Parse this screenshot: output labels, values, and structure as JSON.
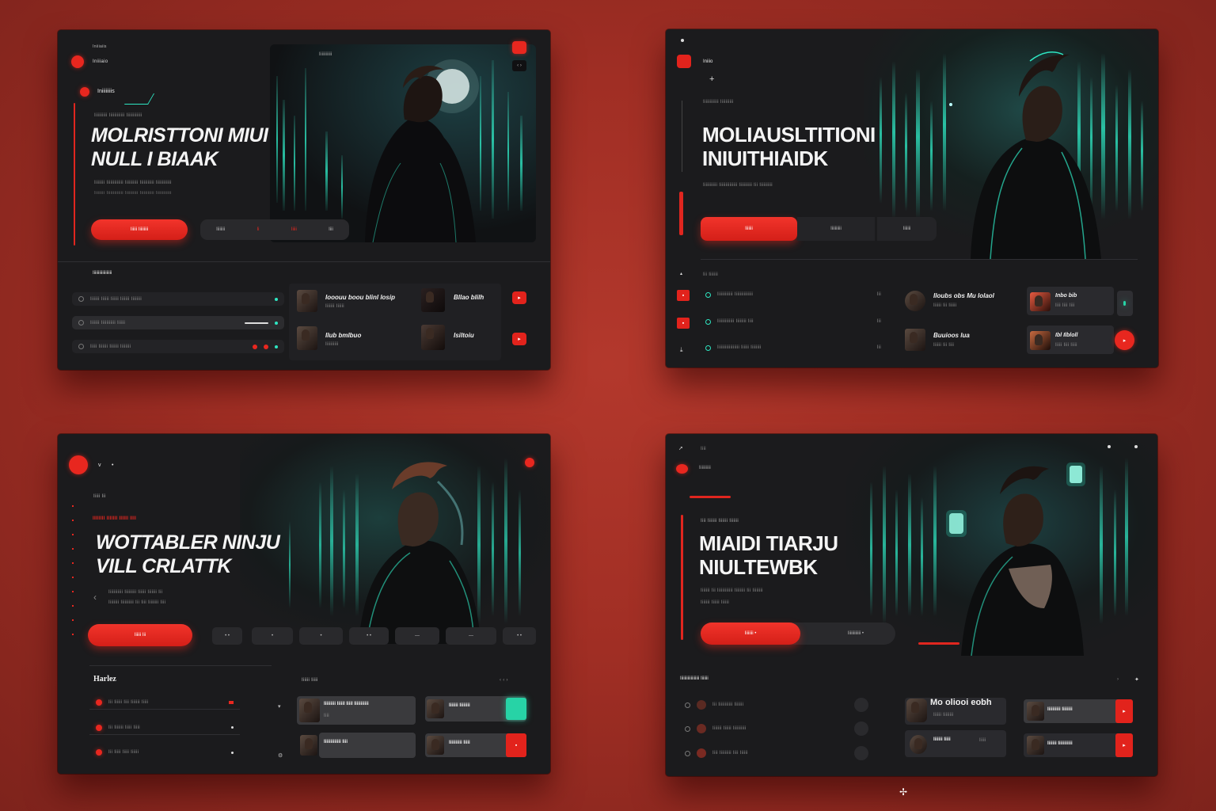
{
  "variant1": {
    "logo_label": "Iniiiaio",
    "top_tag": "Iniiiaiis",
    "section_tag": "Iniiiiiiiis",
    "subtitle": "Iiiiiiiiii Iiiiiiiiiiii Iiiiiiiiiiii",
    "headline_line1": "MOLRISTTONI MIUI",
    "headline_line2": "NULL I BIAAK",
    "body_text": "Iiiiiiii Iiiiiiiiiiiii Iiiiiiiiii Iiiiiiiiiii Iiiiiiiiiiii",
    "primary_button": "Iiiiii Iiiiiiiii",
    "segment_buttons": [
      "Iiiiiiii",
      "Ii",
      "Iiiii",
      "Iiii"
    ],
    "panel_label": "Iiiiiiiiii",
    "list_header": "Iiiiiiiiiiiiiiiiii",
    "list_items": [
      "Iiiiiii Iiiiii Iiiiii Iiiiiii Iiiiiiii",
      "Iiiiiii Iiiiiiiiiii Iiiiii",
      "Iiiii Iiiiiii Iiiiiii Iiiiiiii"
    ],
    "cards": [
      {
        "title": "Iooouu boou blinl losip",
        "sub": "Iiiiiii Iiiiii"
      },
      {
        "title": "Bllao blilh",
        "sub": ""
      },
      {
        "title": "Ilub bmlbuo",
        "sub": "Iiiiiiiiii"
      },
      {
        "title": "Isiltoiu",
        "sub": ""
      }
    ]
  },
  "variant2": {
    "logo_label": "Iniiio",
    "plus": "+",
    "subtitle": "Iiiiiiiiiiii Iiiiiiiiii",
    "headline_line1": "MOLIAUSLTITIONI",
    "headline_line2": "INIUITHIAIDK",
    "body_text": "Iiiiiiiiiii Iiiiiiiiiiiiii Iiiiiiiiii Iii Iiiiiiiiii",
    "primary_button": "Iiiiiii",
    "secondary_buttons": [
      "Iiiiiiiiii",
      "Iiiiiii"
    ],
    "list_header": "Iii Iiiiiii",
    "list_items": [
      "Iiiiiiiiiiii Iiiiiiiiiiiiii",
      "Iiiiiiiiiiiii Iiiiiiii Iiii",
      "Iiiiiiiiiiiiiiiii Iiiiii Iiiiiiii"
    ],
    "list_meta": [
      "Iii",
      "Iii",
      "Iii"
    ],
    "cards": [
      {
        "title": "Iloubs obs Mu Iolaol",
        "sub": "Iiiiii Iii Iiiiii"
      },
      {
        "title": "Inbo bib",
        "sub": "Iiii Iiii Iiii"
      },
      {
        "title": "Buuioos lua",
        "sub": "Iiiiii Iii Iiii"
      },
      {
        "title": "Ibl Ilbloll",
        "sub": "Iiiii Iiii Iiiii"
      }
    ]
  },
  "variant3": {
    "nav_items": [
      "v",
      "•"
    ],
    "eyebrow": "Iiiii Iii",
    "tagline": "IIIIIIII IIIIIII IIIIII IIII",
    "headline_line1": "WOTTABLER NINJU",
    "headline_line2": "VILL CRLATTK",
    "body_line1": "Iiiiiiiiiii Iiiiiiiii Iiiiii Iiiiiii Iii",
    "body_line2": "Iiiiiiii Iiiiiiiiii Iii Iiii Iiiiiiii Iiii",
    "primary_button": "Iiiiii Iii",
    "segment_buttons": [
      "• •",
      "•",
      "•",
      "• •",
      "—",
      "—",
      "• •"
    ],
    "list_header": "Harlez",
    "list_sub_header": "Iiiiii Iiiii",
    "list_items": [
      "Iii Iiiiii Iiii Iiiiiii Iiiii",
      "Iii Iiiiiii Iiiii Iiiii",
      "Iii Iiiii Iiiii Iiiiii"
    ],
    "cards": [
      {
        "title": "Iiiiiiiii Iiiiil Iiiil Iiiiiiiiiii",
        "sub": "Iiii"
      },
      {
        "title": "Iiiiiii Iiiiiiii",
        "sub": ""
      },
      {
        "title": "Iiiiiiiiiiiii Iiii",
        "sub": ""
      },
      {
        "title": "Iiiiiiiiii Iiiii",
        "sub": ""
      }
    ]
  },
  "variant4": {
    "top_nav": [
      "Ii",
      "Iiii"
    ],
    "logo_label": "Iiiiiiiii",
    "eyebrow": "Iiii Iiiiiii Iiiiiii Iiiiiii",
    "headline_line1": "MIAIDI TIARJU",
    "headline_line2": "NIULTEWBK",
    "body_line1": "Iiiiiii Iii Iiiiiiiiiiii Iiiiiiii Iii Iiiiiiii",
    "body_line2": "Iiiiiii Iiiiii Iiiiii",
    "primary_button": "Iiiiiiii •",
    "secondary_button": "Iiiiiiiiiiii •",
    "list_header": "Iiiiiiiiiiiiiiiiii Iiiiiii",
    "list_items": [
      "Iii Iiiiiiiiiii Iiiiiii",
      "Iiiiiii Iiiiii Iiiiiiiiii",
      "Iiii Iiiiiiiii Iiii Iiiiii"
    ],
    "cards": [
      {
        "title": "Mo oliooi eobh",
        "sub": "Iiiiii Iiiiiiii"
      },
      {
        "title": "Iiiiiiiiii Iiiiiiii",
        "sub": ""
      },
      {
        "title": "Iiiiiii Iiiii",
        "sub": "Iiiii"
      },
      {
        "title": "Iiiiiii Iiiiiiiiiii",
        "sub": ""
      }
    ],
    "footer_mark": "✢"
  },
  "icons": [
    "play-icon",
    "plus-icon",
    "chevron-icon",
    "record-icon",
    "heart-icon"
  ],
  "colors": {
    "accent_red": "#e8271f",
    "glow_teal": "#2ee6c2",
    "panel": "#1b1b1d",
    "backdrop": "#a02e24"
  }
}
